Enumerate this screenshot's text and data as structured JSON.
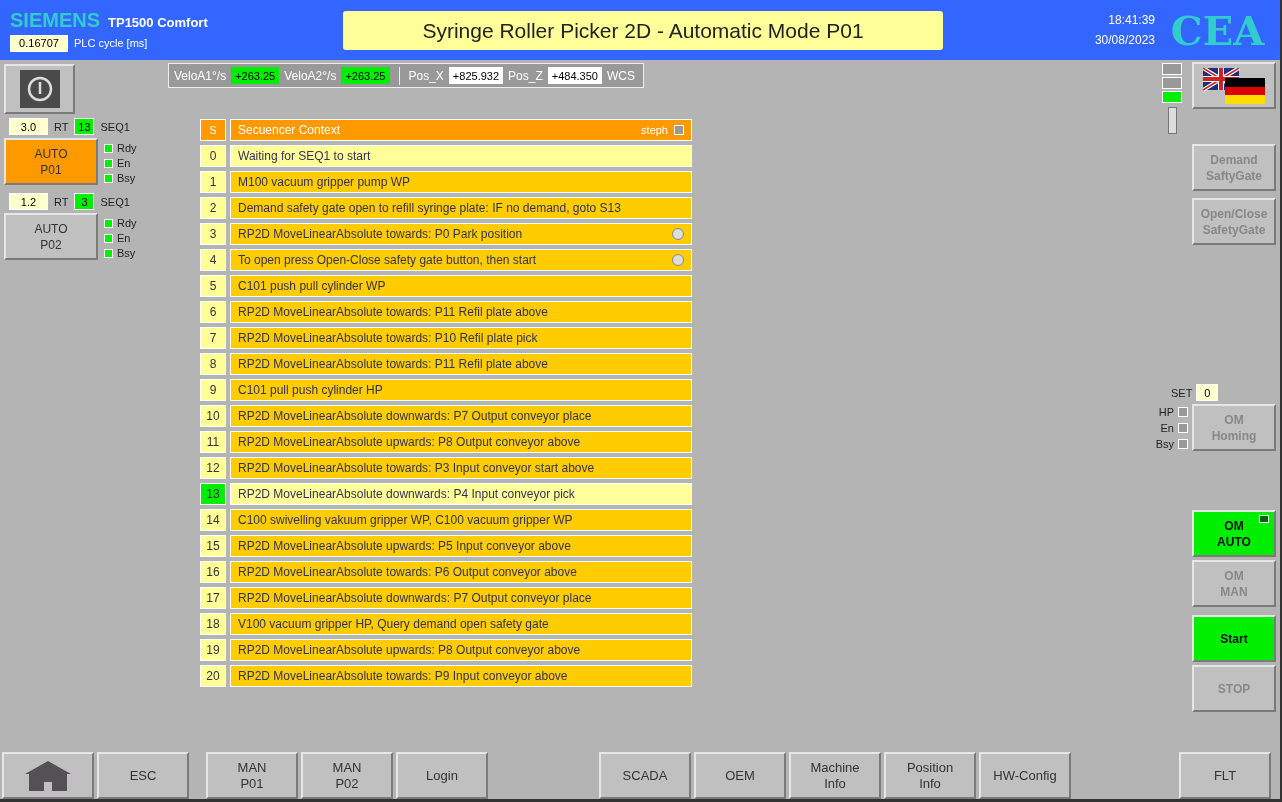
{
  "header": {
    "brand": "SIEMENS",
    "model": "TP1500 Comfort",
    "plc_cycle": {
      "value": "0.16707",
      "label": "PLC cycle [ms]"
    },
    "title": "Syringe Roller Picker 2D - Automatic Mode P01",
    "time": "18:41:39",
    "date": "30/08/2023",
    "logo": "CEA"
  },
  "readouts": [
    {
      "label": "VeloA1°/s",
      "value": "+263.25",
      "kind": "live"
    },
    {
      "label": "VeloA2°/s",
      "value": "+263.25",
      "kind": "live"
    },
    {
      "label": "Pos_X",
      "value": "+825.932",
      "kind": "position"
    },
    {
      "label": "Pos_Z",
      "value": "+484.350",
      "kind": "position"
    }
  ],
  "readout_unit": "WCS",
  "programs": [
    {
      "time": "3.0",
      "time_label": "RT",
      "step": "13",
      "seq": "SEQ1",
      "lines": [
        "AUTO",
        "P01"
      ],
      "selected": true,
      "leds": [
        {
          "label": "Rdy",
          "on": true
        },
        {
          "label": "En",
          "on": true
        },
        {
          "label": "Bsy",
          "on": true
        }
      ]
    },
    {
      "time": "1.2",
      "time_label": "RT",
      "step": "3",
      "seq": "SEQ1",
      "lines": [
        "AUTO",
        "P02"
      ],
      "selected": false,
      "leds": [
        {
          "label": "Rdy",
          "on": true
        },
        {
          "label": "En",
          "on": true
        },
        {
          "label": "Bsy",
          "on": true
        }
      ]
    }
  ],
  "sequence": {
    "header": {
      "step": "S",
      "title": "Secuencer Context",
      "option": "steph",
      "checked": false
    },
    "rows": [
      {
        "step": "0",
        "text": "Waiting for SEQ1 to start",
        "highlighted": true,
        "active": false,
        "indicator": false
      },
      {
        "step": "1",
        "text": "M100 vacuum gripper pump WP",
        "highlighted": false,
        "active": false,
        "indicator": false
      },
      {
        "step": "2",
        "text": "Demand safety gate open to refill syringe plate: IF no demand, goto S13",
        "highlighted": false,
        "active": false,
        "indicator": false
      },
      {
        "step": "3",
        "text": "RP2D MoveLinearAbsolute towards: P0 Park position",
        "highlighted": false,
        "active": false,
        "indicator": true
      },
      {
        "step": "4",
        "text": "To open press Open-Close safety gate button, then start",
        "highlighted": false,
        "active": false,
        "indicator": true
      },
      {
        "step": "5",
        "text": "C101 push pull cylinder WP",
        "highlighted": false,
        "active": false,
        "indicator": false
      },
      {
        "step": "6",
        "text": "RP2D MoveLinearAbsolute towards: P11 Refil plate above",
        "highlighted": false,
        "active": false,
        "indicator": false
      },
      {
        "step": "7",
        "text": "RP2D MoveLinearAbsolute towards: P10 Refil plate pick",
        "highlighted": false,
        "active": false,
        "indicator": false
      },
      {
        "step": "8",
        "text": "RP2D MoveLinearAbsolute towards: P11 Refil plate above",
        "highlighted": false,
        "active": false,
        "indicator": false
      },
      {
        "step": "9",
        "text": "C101 pull push cylinder HP",
        "highlighted": false,
        "active": false,
        "indicator": false
      },
      {
        "step": "10",
        "text": "RP2D MoveLinearAbsolute downwards: P7 Output conveyor place",
        "highlighted": false,
        "active": false,
        "indicator": false
      },
      {
        "step": "11",
        "text": "RP2D MoveLinearAbsolute upwards: P8 Output conveyor above",
        "highlighted": false,
        "active": false,
        "indicator": false
      },
      {
        "step": "12",
        "text": "RP2D MoveLinearAbsolute towards: P3 Input conveyor start above",
        "highlighted": false,
        "active": false,
        "indicator": false
      },
      {
        "step": "13",
        "text": "RP2D MoveLinearAbsolute downwards: P4 Input conveyor pick",
        "highlighted": true,
        "active": true,
        "indicator": false
      },
      {
        "step": "14",
        "text": "C100 swivelling vakuum gripper WP, C100 vacuum gripper WP",
        "highlighted": false,
        "active": false,
        "indicator": false
      },
      {
        "step": "15",
        "text": "RP2D MoveLinearAbsolute upwards: P5 Input conveyor above",
        "highlighted": false,
        "active": false,
        "indicator": false
      },
      {
        "step": "16",
        "text": "RP2D MoveLinearAbsolute towards: P6 Output conveyor above",
        "highlighted": false,
        "active": false,
        "indicator": false
      },
      {
        "step": "17",
        "text": "RP2D MoveLinearAbsolute downwards: P7 Output conveyor place",
        "highlighted": false,
        "active": false,
        "indicator": false
      },
      {
        "step": "18",
        "text": "V100 vacuum gripper HP, Query demand open safety gate",
        "highlighted": false,
        "active": false,
        "indicator": false
      },
      {
        "step": "19",
        "text": "RP2D MoveLinearAbsolute upwards: P8 Output conveyor above",
        "highlighted": false,
        "active": false,
        "indicator": false
      },
      {
        "step": "20",
        "text": "RP2D MoveLinearAbsolute towards: P9 Input conveyor above",
        "highlighted": false,
        "active": false,
        "indicator": false
      }
    ]
  },
  "status_lights": [
    {
      "on": false
    },
    {
      "on": false
    },
    {
      "on": true
    }
  ],
  "gate_buttons": [
    {
      "lines": [
        "Demand",
        "SaftyGate"
      ],
      "disabled": true
    },
    {
      "lines": [
        "Open/Close",
        "SafetyGate"
      ],
      "disabled": true
    }
  ],
  "homing": {
    "set_label": "SET",
    "set_value": "0",
    "flags": [
      {
        "label": "HP",
        "on": false
      },
      {
        "label": "En",
        "on": false
      },
      {
        "label": "Bsy",
        "on": false
      }
    ],
    "button": {
      "lines": [
        "OM",
        "Homing"
      ],
      "disabled": true
    }
  },
  "mode_buttons": [
    {
      "lines": [
        "OM",
        "AUTO"
      ],
      "selected": true,
      "disabled": false
    },
    {
      "lines": [
        "OM",
        "MAN"
      ],
      "selected": false,
      "disabled": true
    }
  ],
  "control_buttons": [
    {
      "label": "Start",
      "active": true,
      "disabled": false
    },
    {
      "label": "STOP",
      "active": false,
      "disabled": true
    }
  ],
  "footer": [
    [
      {
        "kind": "home"
      },
      {
        "kind": "text",
        "lines": [
          "ESC"
        ]
      }
    ],
    [
      {
        "kind": "text",
        "lines": [
          "MAN",
          "P01"
        ]
      },
      {
        "kind": "text",
        "lines": [
          "MAN",
          "P02"
        ]
      },
      {
        "kind": "text",
        "lines": [
          "Login"
        ]
      }
    ],
    [
      {
        "kind": "text",
        "lines": [
          "SCADA"
        ]
      },
      {
        "kind": "text",
        "lines": [
          "OEM"
        ]
      },
      {
        "kind": "text",
        "lines": [
          "Machine",
          "Info"
        ]
      },
      {
        "kind": "text",
        "lines": [
          "Position",
          "Info"
        ]
      },
      {
        "kind": "text",
        "lines": [
          "HW-Config"
        ]
      }
    ],
    [
      {
        "kind": "text",
        "lines": [
          "FLT"
        ]
      }
    ]
  ]
}
